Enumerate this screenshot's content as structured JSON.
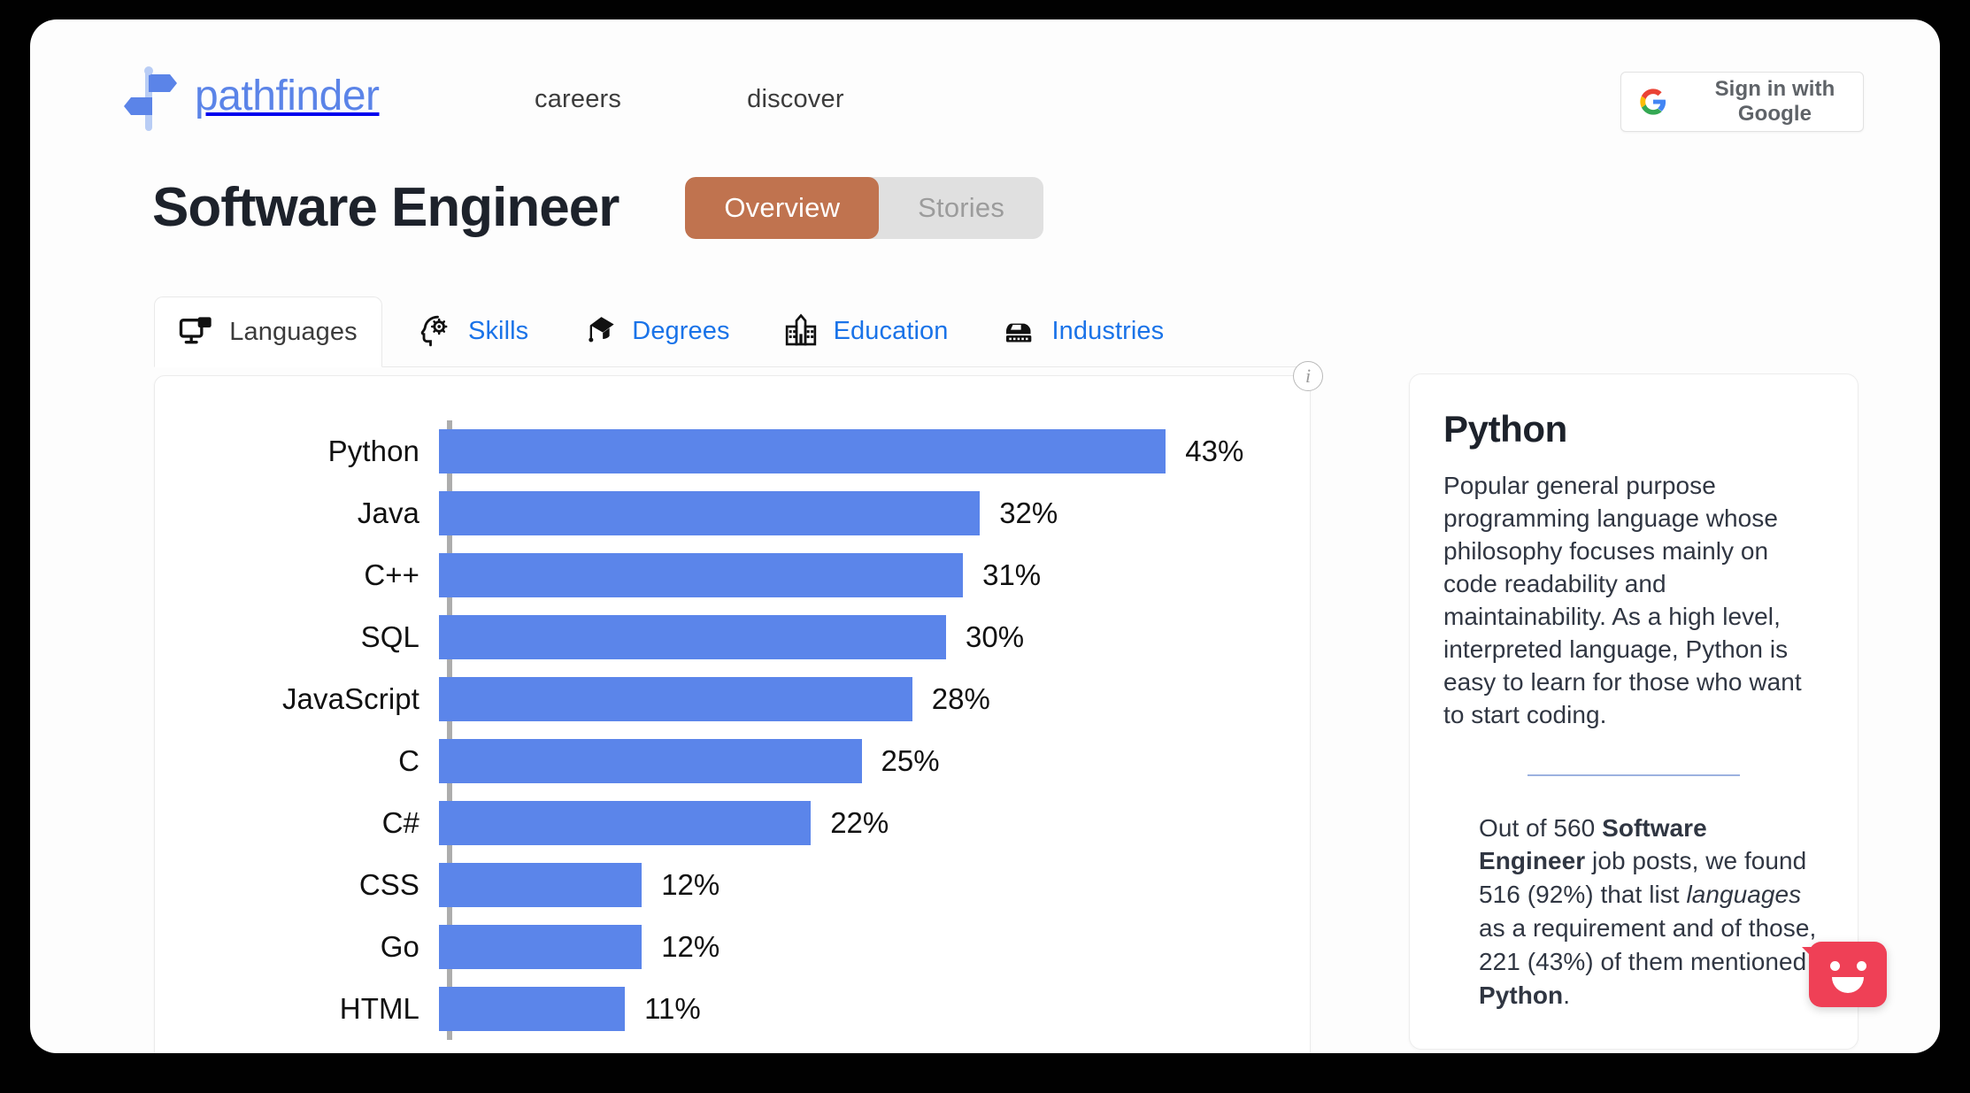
{
  "header": {
    "brand_name": "pathfinder",
    "brand_logo_icon": "signpost-icon",
    "nav": [
      {
        "label": "careers"
      },
      {
        "label": "discover"
      }
    ],
    "signin": {
      "label": "Sign in with Google",
      "icon": "google-g-icon"
    }
  },
  "page_title": "Software Engineer",
  "view_toggle": {
    "options": [
      {
        "label": "Overview",
        "active": true
      },
      {
        "label": "Stories",
        "active": false
      }
    ],
    "active_color": "#c0734f",
    "inactive_bg": "#e0e0e0"
  },
  "facet_tabs": [
    {
      "label": "Languages",
      "icon": "monitor-code-icon",
      "active": true
    },
    {
      "label": "Skills",
      "icon": "head-gear-icon",
      "active": false
    },
    {
      "label": "Degrees",
      "icon": "graduation-cap-icon",
      "active": false
    },
    {
      "label": "Education",
      "icon": "school-building-icon",
      "active": false
    },
    {
      "label": "Industries",
      "icon": "factory-icon",
      "active": false
    }
  ],
  "chart_info_icon": "info-icon",
  "chart_data": {
    "type": "bar",
    "orientation": "horizontal",
    "title": "",
    "xlabel": "",
    "ylabel": "",
    "grid": false,
    "legend": null,
    "xlim": [
      0,
      50
    ],
    "categories": [
      "Python",
      "Java",
      "C++",
      "SQL",
      "JavaScript",
      "C",
      "C#",
      "CSS",
      "Go",
      "HTML"
    ],
    "values": [
      43,
      32,
      31,
      30,
      28,
      25,
      22,
      12,
      12,
      11
    ],
    "value_labels": [
      "43%",
      "32%",
      "31%",
      "30%",
      "28%",
      "25%",
      "22%",
      "12%",
      "12%",
      "11%"
    ],
    "bar_color": "#5b85ea",
    "axis_color": "#adadad"
  },
  "info_panel": {
    "title": "Python",
    "description": "Popular general purpose programming language whose philosophy focuses mainly on code readability and maintainability. As a high level, interpreted language, Python is easy to learn for those who want to start coding.",
    "stat": {
      "prefix": "Out of 560 ",
      "role": "Software Engineer",
      "mid1": " job posts, we found 516 (92%) that list ",
      "facet": "languages",
      "mid2": " as a requirement and of those, 221 (43%) of them mentioned ",
      "item": "Python",
      "suffix": "."
    }
  },
  "chat_widget": {
    "icon": "chat-smiley-icon",
    "color": "#ef4056"
  }
}
